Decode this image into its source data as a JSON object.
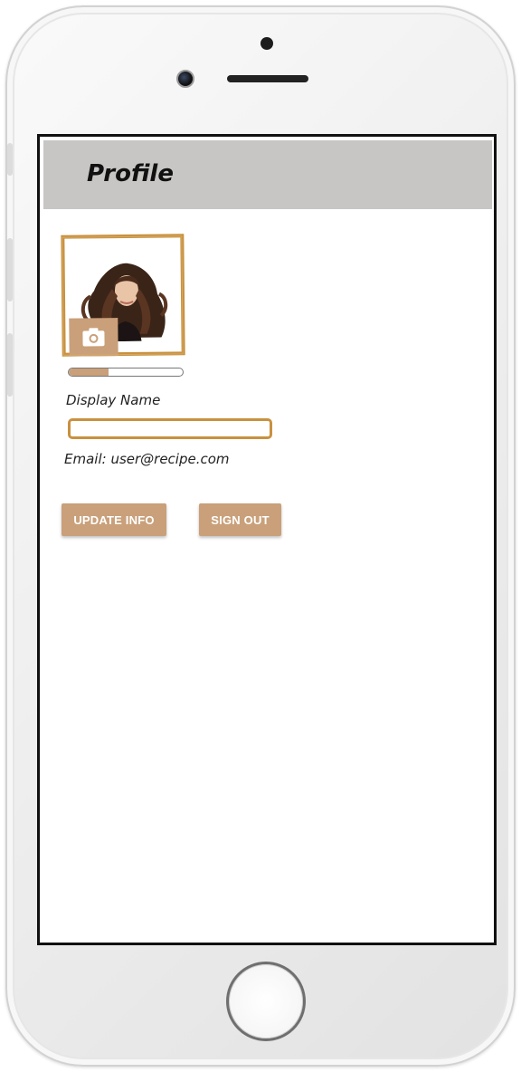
{
  "app": {
    "title": "Profile"
  },
  "profile": {
    "display_name_label": "Display Name",
    "display_name_value": "",
    "display_name_placeholder": "",
    "email_text": "Email: user@recipe.com",
    "upload_progress": 0.35
  },
  "actions": {
    "update_label": "UPDATE INFO",
    "signout_label": "SIGN OUT"
  },
  "icons": {
    "camera": "camera-icon",
    "home": "home-button"
  },
  "colors": {
    "accent": "#c9a07a",
    "frame": "#c8913f",
    "appbar": "#c7c6c4"
  }
}
